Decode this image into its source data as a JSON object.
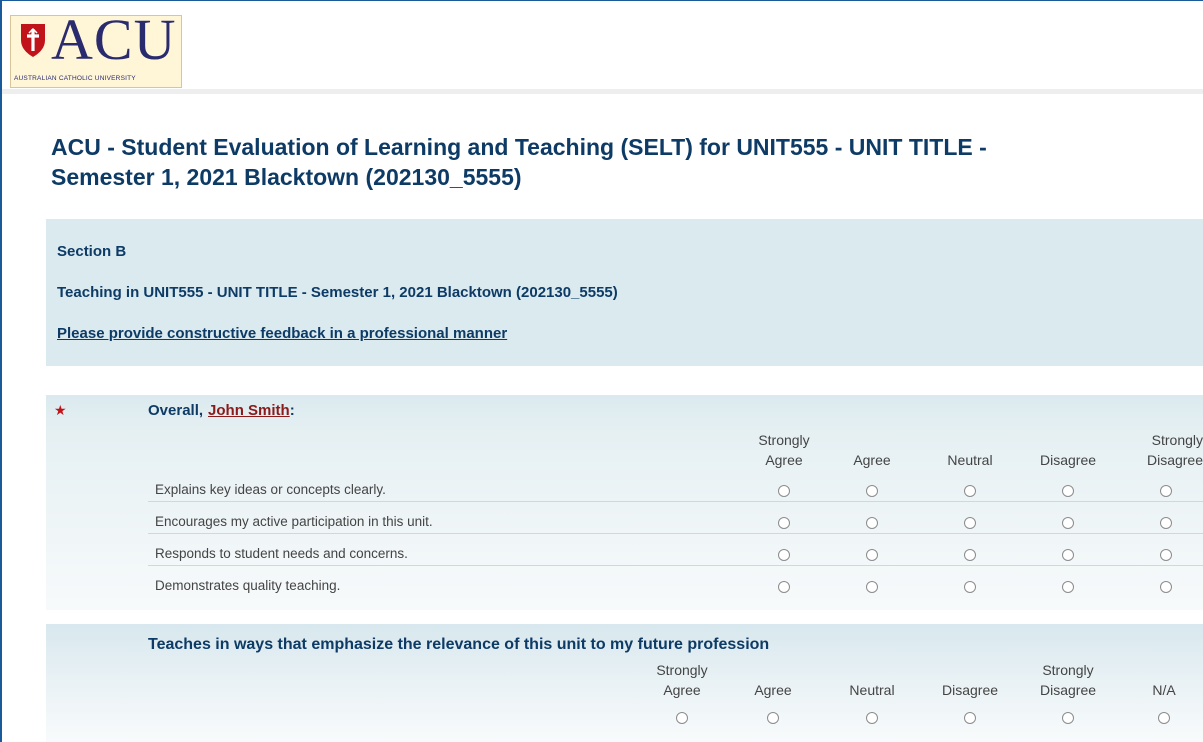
{
  "brand": {
    "logo_text": "ACU",
    "logo_subtitle": "AUSTRALIAN CATHOLIC UNIVERSITY",
    "primary_color": "#0d3b66",
    "logo_color": "#2a2b6e",
    "accent_red": "#c0141a"
  },
  "page": {
    "title_line1": "ACU - Student Evaluation of Learning and Teaching (SELT) for UNIT555 - UNIT TITLE -",
    "title_line2": "Semester 1, 2021 Blacktown (202130_5555)"
  },
  "section": {
    "label": "Section B",
    "teaching": "Teaching in UNIT555 - UNIT TITLE - Semester 1, 2021 Blacktown (202130_5555)",
    "feedback_link": "Please provide constructive feedback in a professional manner"
  },
  "question1": {
    "required_marker": "★",
    "prefix": "Overall,",
    "name": "John Smith",
    "suffix": ":",
    "scale": [
      {
        "line1": "Strongly",
        "line2": "Agree"
      },
      {
        "line1": "",
        "line2": "Agree"
      },
      {
        "line1": "",
        "line2": "Neutral"
      },
      {
        "line1": "",
        "line2": "Disagree"
      },
      {
        "line1": "Strongly",
        "line2": "Disagree"
      }
    ],
    "rows": [
      {
        "label": "Explains key ideas or concepts clearly."
      },
      {
        "label": "Encourages my active participation in this unit."
      },
      {
        "label": "Responds to student needs and concerns."
      },
      {
        "label": "Demonstrates quality teaching."
      }
    ]
  },
  "question2": {
    "heading": "Teaches in ways that emphasize the relevance of this unit to my future profession",
    "scale": [
      {
        "line1": "Strongly",
        "line2": "Agree"
      },
      {
        "line1": "",
        "line2": "Agree"
      },
      {
        "line1": "",
        "line2": "Neutral"
      },
      {
        "line1": "",
        "line2": "Disagree"
      },
      {
        "line1": "Strongly",
        "line2": "Disagree"
      },
      {
        "line1": "",
        "line2": "N/A"
      }
    ]
  }
}
